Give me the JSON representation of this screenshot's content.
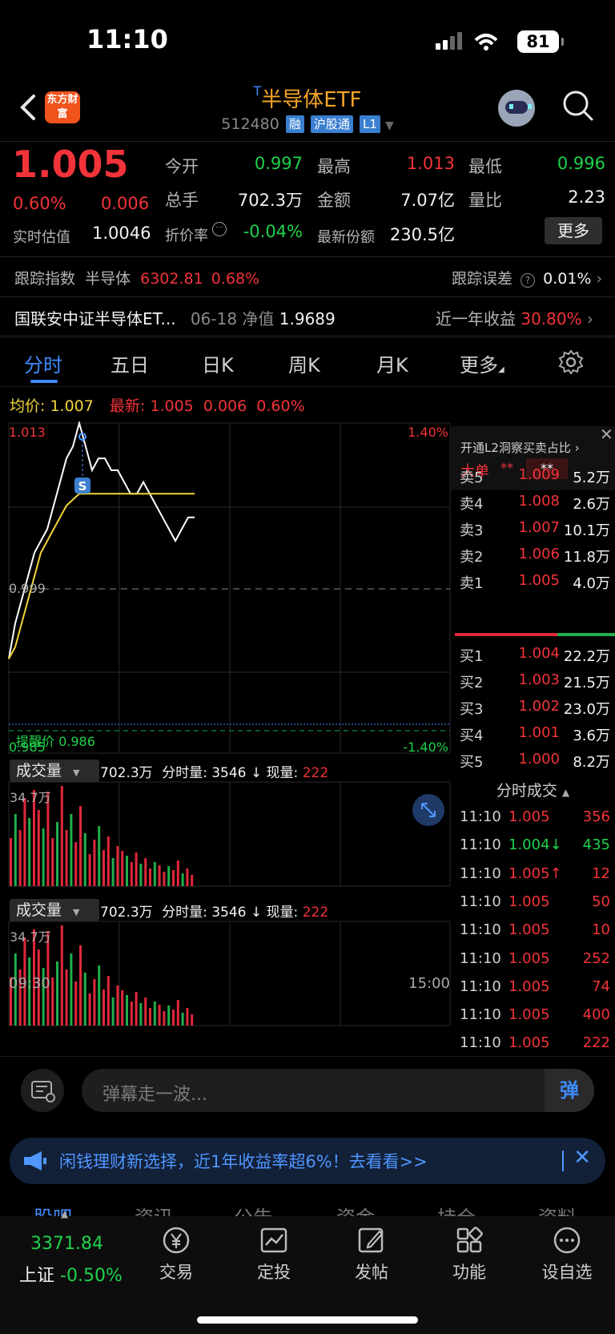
{
  "status_bar": {
    "time": "11:10",
    "battery": "81"
  },
  "header": {
    "logo_text": "东方财富",
    "title_prefix": "T",
    "title": "半导体ETF",
    "code": "512480",
    "tags": [
      "融",
      "沪股通",
      "L1"
    ]
  },
  "quote": {
    "price": "1.005",
    "change_pct": "0.60%",
    "change": "0.006",
    "open_label": "今开",
    "open": "0.997",
    "high_label": "最高",
    "high": "1.013",
    "low_label": "最低",
    "low": "0.996",
    "volume_label": "总手",
    "volume": "702.3万",
    "amount_label": "金额",
    "amount": "7.07亿",
    "ratio_label": "量比",
    "ratio": "2.23",
    "iopv_label": "实时估值",
    "iopv": "1.0046",
    "discount_label": "折价率",
    "discount": "-0.04%",
    "shares_label": "最新份额",
    "shares": "230.5亿",
    "more_button": "更多"
  },
  "tracking": {
    "index_label": "跟踪指数",
    "index_name": "半导体",
    "index_value": "6302.81",
    "index_pct": "0.68%",
    "error_label": "跟踪误差",
    "error_value": "0.01%"
  },
  "fund": {
    "name": "国联安中证半导体ET...",
    "nav_date": "06-18",
    "nav_label": "净值",
    "nav": "1.9689",
    "return_label": "近一年收益",
    "return_value": "30.80%"
  },
  "tabs": [
    "分时",
    "五日",
    "日K",
    "周K",
    "月K",
    "更多"
  ],
  "avg_row": {
    "avg_label": "均价:",
    "avg_value": "1.007",
    "last_label": "最新:",
    "last_value": "1.005",
    "last_change": "0.006",
    "last_pct": "0.60%"
  },
  "chart_labels": {
    "top_price": "1.013",
    "top_pct": "1.40%",
    "mid_price": "0.999",
    "bottom_price": "0.985",
    "bottom_pct": "-1.40%",
    "alert_label": "提醒价 0.986",
    "marker": "S",
    "time_start": "09:30",
    "time_end": "15:00"
  },
  "volume_panel": {
    "selector": "成交量",
    "total": "702.3万",
    "minute_label": "分时量:",
    "minute_value": "3546",
    "now_label": "现量:",
    "now_value": "222",
    "max_label": "34.7万"
  },
  "chart_data": {
    "type": "line",
    "xlabel": "",
    "ylabel": "",
    "ylim": [
      0.985,
      1.013
    ],
    "x_range": [
      "09:30",
      "15:00"
    ],
    "series": [
      {
        "name": "",
        "color": "#ffffff",
        "values": [
          0.993,
          0.996,
          0.998,
          1.0,
          1.002,
          1.003,
          1.004,
          1.006,
          1.008,
          1.01,
          1.011,
          1.013,
          1.011,
          1.009,
          1.01,
          1.01,
          1.009,
          1.009,
          1.008,
          1.007,
          1.007,
          1.008,
          1.007,
          1.006,
          1.005,
          1.004,
          1.003,
          1.004,
          1.005,
          1.005
        ]
      },
      {
        "name": "",
        "color": "#f2d43a",
        "values": [
          0.993,
          0.994,
          0.996,
          0.998,
          1.0,
          1.002,
          1.003,
          1.004,
          1.005,
          1.006,
          1.0065,
          1.007,
          1.007,
          1.007,
          1.007,
          1.007,
          1.007,
          1.007,
          1.007,
          1.007,
          1.007,
          1.007,
          1.007,
          1.007,
          1.007,
          1.007,
          1.007,
          1.007,
          1.007,
          1.007
        ]
      }
    ],
    "reference_price": 0.999,
    "alert_price": 0.986
  },
  "order_book": {
    "l2_promo": "开通L2洞察买卖占比",
    "big_label": "大单",
    "big_masked": "**",
    "big_masked2": "**",
    "asks": [
      {
        "k": "卖5",
        "p": "1.009",
        "v": "5.2万"
      },
      {
        "k": "卖4",
        "p": "1.008",
        "v": "2.6万"
      },
      {
        "k": "卖3",
        "p": "1.007",
        "v": "10.1万"
      },
      {
        "k": "卖2",
        "p": "1.006",
        "v": "11.8万"
      },
      {
        "k": "卖1",
        "p": "1.005",
        "v": "4.0万"
      }
    ],
    "bids": [
      {
        "k": "买1",
        "p": "1.004",
        "v": "22.2万"
      },
      {
        "k": "买2",
        "p": "1.003",
        "v": "21.5万"
      },
      {
        "k": "买3",
        "p": "1.002",
        "v": "23.0万"
      },
      {
        "k": "买4",
        "p": "1.001",
        "v": "3.6万"
      },
      {
        "k": "买5",
        "p": "1.000",
        "v": "8.2万"
      }
    ],
    "trades_title": "分时成交",
    "trades": [
      {
        "t": "11:10",
        "p": "1.005",
        "v": "356",
        "c": "#f2333a"
      },
      {
        "t": "11:10",
        "p": "1.004↓",
        "v": "435",
        "c": "#1fd14c"
      },
      {
        "t": "11:10",
        "p": "1.005↑",
        "v": "12",
        "c": "#f2333a"
      },
      {
        "t": "11:10",
        "p": "1.005",
        "v": "50",
        "c": "#f2333a"
      },
      {
        "t": "11:10",
        "p": "1.005",
        "v": "10",
        "c": "#f2333a"
      },
      {
        "t": "11:10",
        "p": "1.005",
        "v": "252",
        "c": "#f2333a"
      },
      {
        "t": "11:10",
        "p": "1.005",
        "v": "74",
        "c": "#f2333a"
      },
      {
        "t": "11:10",
        "p": "1.005",
        "v": "400",
        "c": "#f2333a"
      },
      {
        "t": "11:10",
        "p": "1.005",
        "v": "222",
        "c": "#f2333a"
      }
    ]
  },
  "danmaku": {
    "placeholder": "弹幕走一波...",
    "send": "弹"
  },
  "banner": {
    "text": "闲钱理财新选择，近1年收益率超6%！去看看>>"
  },
  "subtabs": [
    "股吧",
    "资讯",
    "公告",
    "资金",
    "持仓",
    "资料"
  ],
  "bottom_bar": {
    "index_value": "3371.84",
    "index_name": "上证",
    "index_pct": "-0.50%",
    "items": [
      "交易",
      "定投",
      "发帖",
      "功能",
      "设自选"
    ]
  }
}
